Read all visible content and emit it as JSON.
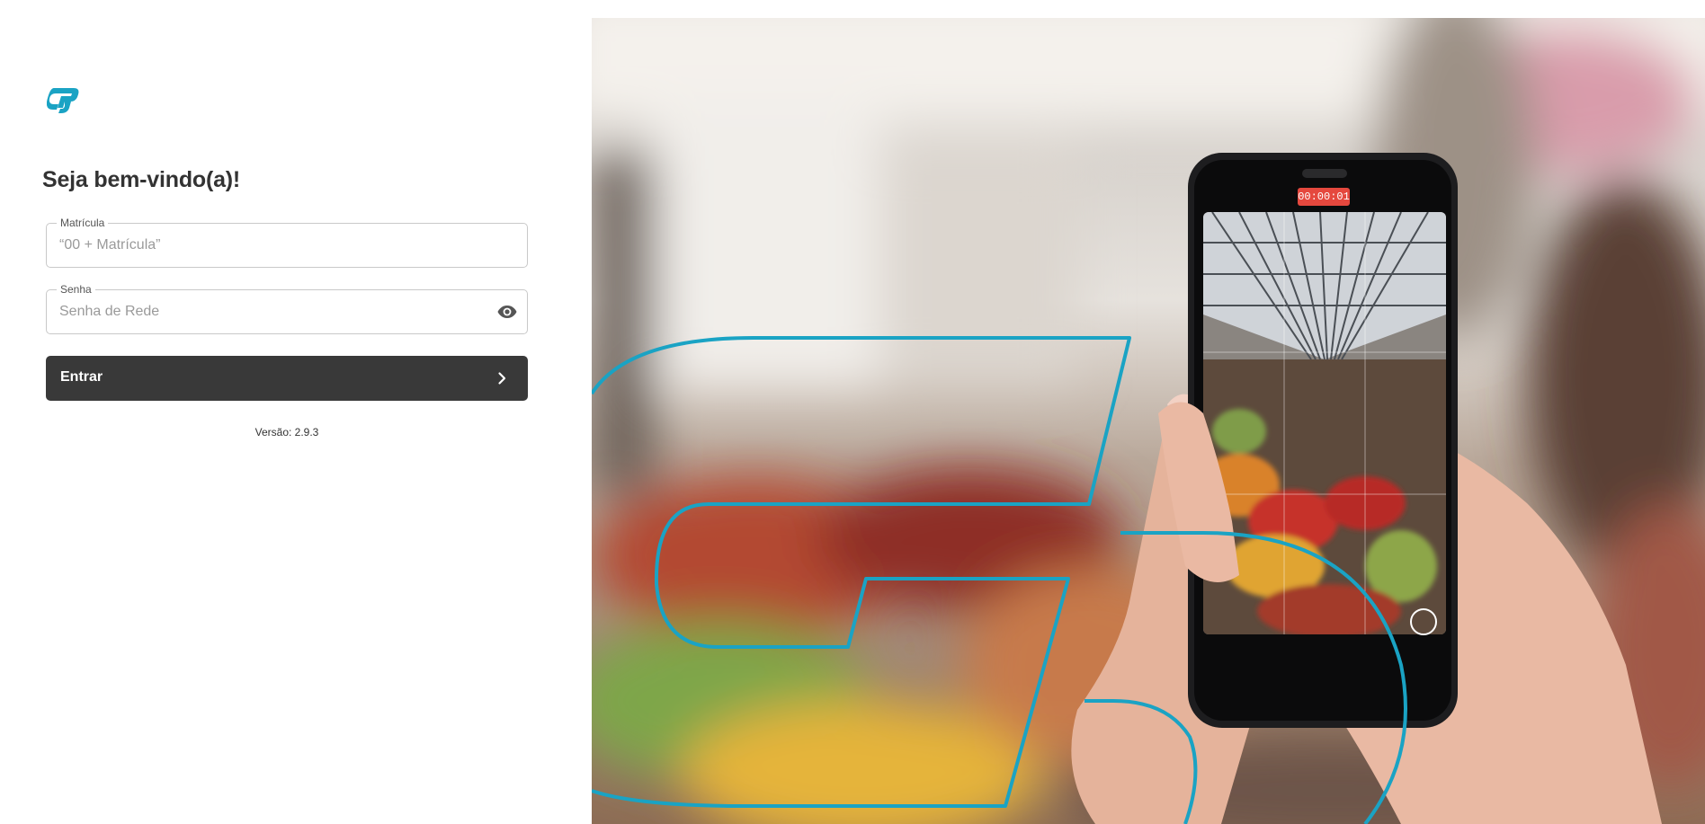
{
  "login": {
    "title": "Seja bem-vindo(a)!",
    "matricula": {
      "label": "Matrícula",
      "placeholder": "“00 + Matrícula”",
      "value": ""
    },
    "senha": {
      "label": "Senha",
      "placeholder": "Senha de Rede",
      "value": "",
      "toggle_icon": "eye-icon"
    },
    "submit": {
      "label": "Entrar",
      "icon": "chevron-right-icon"
    },
    "version_text": "Versão: 2.9.3"
  },
  "brand": {
    "logo_icon": "cp-logo-icon",
    "accent_color": "#1aa3c4",
    "button_color": "#393939"
  },
  "hero": {
    "recording_timer": "00:00:01"
  }
}
